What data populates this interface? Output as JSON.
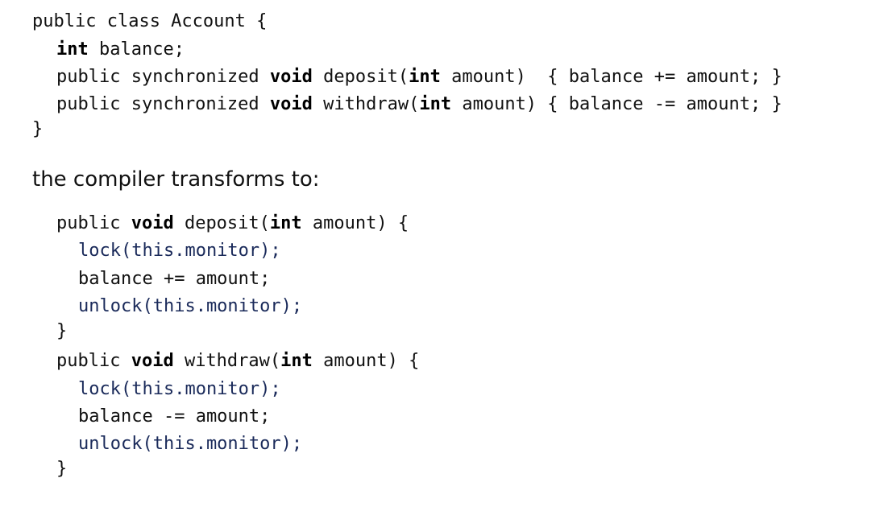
{
  "original_code": {
    "class_open": "public class Account {",
    "field_kw": "int",
    "field_rest": " balance;",
    "deposit": {
      "pre": "public synchronized ",
      "kw1": "void",
      "mid": " deposit(",
      "kw2": "int",
      "post": " amount)  { balance += amount; }"
    },
    "withdraw": {
      "pre": "public synchronized ",
      "kw1": "void",
      "mid": " withdraw(",
      "kw2": "int",
      "post": " amount) { balance -= amount; }"
    },
    "class_close": "}"
  },
  "explanation": "the compiler transforms to:",
  "transformed_code": {
    "deposit_sig": {
      "pre": "public ",
      "kw1": "void",
      "mid": " deposit(",
      "kw2": "int",
      "post": " amount) {"
    },
    "deposit_body": {
      "lock": "lock(this.monitor);",
      "stmt": "balance += amount;",
      "unlock": "unlock(this.monitor);"
    },
    "deposit_close": "}",
    "withdraw_sig": {
      "pre": "public ",
      "kw1": "void",
      "mid": " withdraw(",
      "kw2": "int",
      "post": " amount) {"
    },
    "withdraw_body": {
      "lock": "lock(this.monitor);",
      "stmt": "balance -= amount;",
      "unlock": "unlock(this.monitor);"
    },
    "withdraw_close": "}"
  }
}
